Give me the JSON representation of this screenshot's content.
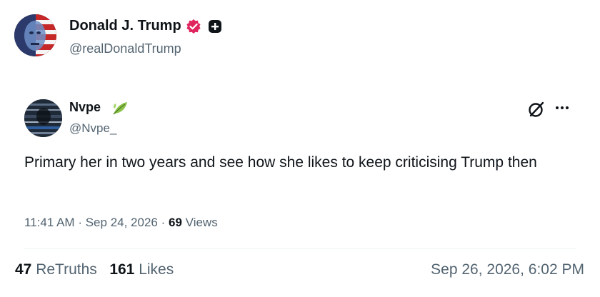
{
  "post": {
    "author_name": "Donald J. Trump",
    "author_handle": "@realDonaldTrump",
    "timestamp": "Sep 26, 2026, 6:02 PM"
  },
  "quote": {
    "name": "Nvpe",
    "handle": "@Nvpe_",
    "text": "Primary her in two years and see how she likes to keep criticising Trump then",
    "time": "11:41 AM",
    "date": "Sep 24, 2026",
    "views_count": "69",
    "views_label": "Views",
    "separator": "·"
  },
  "stats": {
    "retruths_count": "47",
    "retruths_label": "ReTruths",
    "likes_count": "161",
    "likes_label": "Likes"
  },
  "icons": {
    "verified": "verified-icon",
    "plus": "plus-icon",
    "leaf": "leaf-icon",
    "grok": "grok-icon",
    "more": "more-icon"
  },
  "colors": {
    "verified_pink": "#e0245e",
    "secondary_text": "#536471",
    "primary_text": "#0f1419",
    "leaf_green": "#7cb342"
  }
}
